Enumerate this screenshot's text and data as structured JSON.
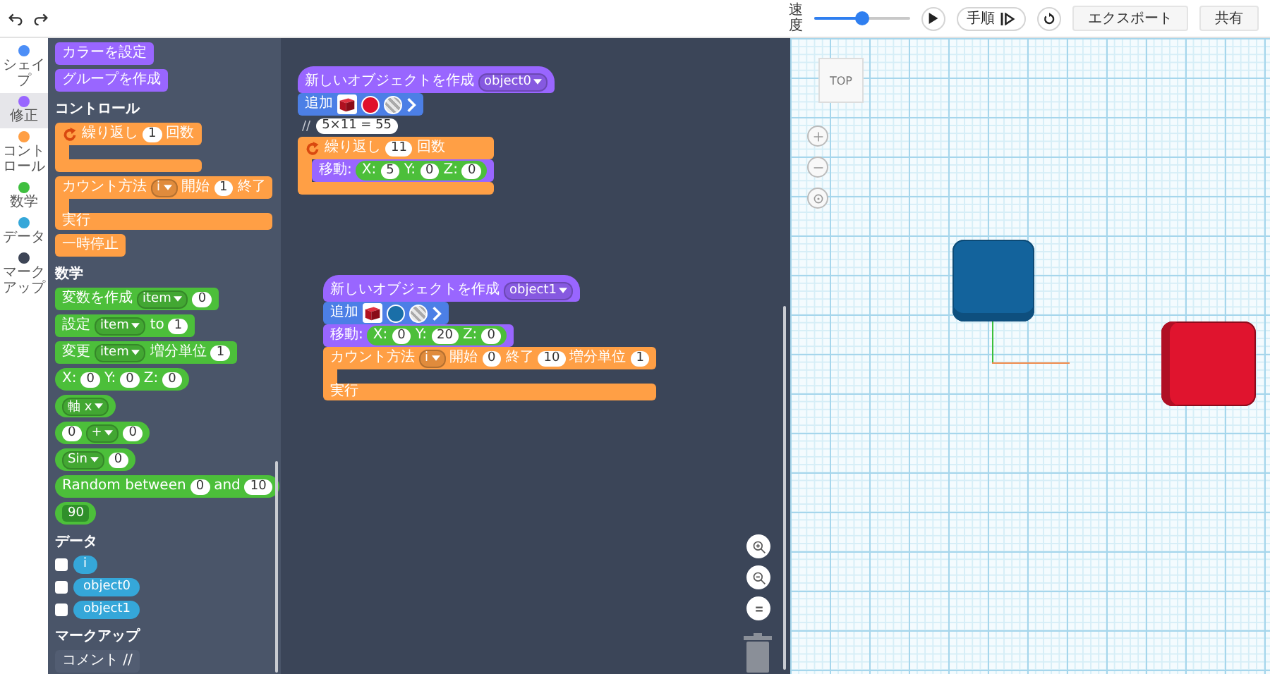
{
  "toolbar": {
    "speed_label": "速度",
    "speed": {
      "level": 0.5
    },
    "step_button": "手順",
    "export_button": "エクスポート",
    "share_button": "共有"
  },
  "categories": [
    {
      "label": "シェイプ",
      "color": "#4c8ef7",
      "selected": false
    },
    {
      "label": "修正",
      "color": "#9966ff",
      "selected": true
    },
    {
      "label": "コントロール",
      "color": "#ff9f45",
      "selected": false
    },
    {
      "label": "数学",
      "color": "#3fbf3f",
      "selected": false
    },
    {
      "label": "データ",
      "color": "#35a7d9",
      "selected": false
    },
    {
      "label": "マークアップ",
      "color": "#3d4556",
      "selected": false
    }
  ],
  "palette": [
    {
      "kind": "block",
      "color": "#9966ff",
      "parts": [
        {
          "kind": "text",
          "text": "カラーを設定"
        }
      ]
    },
    {
      "kind": "block",
      "color": "#9966ff",
      "parts": [
        {
          "kind": "text",
          "text": "グループを作成"
        }
      ]
    },
    {
      "kind": "heading",
      "text": "コントロール"
    },
    {
      "kind": "c_block",
      "color": "#ff9f45",
      "parts": [
        {
          "kind": "repeat_icon"
        },
        {
          "kind": "text",
          "text": "繰り返し"
        },
        {
          "kind": "input",
          "text": "1"
        },
        {
          "kind": "text",
          "text": "回数"
        }
      ]
    },
    {
      "kind": "c_block",
      "color": "#ff9f45",
      "parts": [
        {
          "kind": "text",
          "text": "カウント方法"
        },
        {
          "kind": "dropdown",
          "text": "i"
        },
        {
          "kind": "text",
          "text": "開始"
        },
        {
          "kind": "input",
          "text": "1"
        },
        {
          "kind": "text",
          "text": "終了"
        }
      ],
      "mouth_label": "実行"
    },
    {
      "kind": "block",
      "color": "#ff9f45",
      "parts": [
        {
          "kind": "text",
          "text": "一時停止"
        }
      ]
    },
    {
      "kind": "heading",
      "text": "数学"
    },
    {
      "kind": "block",
      "color": "#4cbf3a",
      "parts": [
        {
          "kind": "text",
          "text": "変数を作成"
        },
        {
          "kind": "dropdown",
          "text": "item"
        },
        {
          "kind": "input",
          "text": "0"
        }
      ]
    },
    {
      "kind": "block",
      "color": "#4cbf3a",
      "parts": [
        {
          "kind": "text",
          "text": "設定"
        },
        {
          "kind": "dropdown",
          "text": "item"
        },
        {
          "kind": "text",
          "text": "to"
        },
        {
          "kind": "input",
          "text": "1"
        }
      ]
    },
    {
      "kind": "block",
      "color": "#4cbf3a",
      "parts": [
        {
          "kind": "text",
          "text": "変更"
        },
        {
          "kind": "dropdown",
          "text": "item"
        },
        {
          "kind": "text",
          "text": "増分単位"
        },
        {
          "kind": "input",
          "text": "1"
        }
      ]
    },
    {
      "kind": "reporter",
      "color": "#4cbf3a",
      "parts": [
        {
          "kind": "text",
          "text": "X:"
        },
        {
          "kind": "input",
          "text": "0"
        },
        {
          "kind": "text",
          "text": "Y:"
        },
        {
          "kind": "input",
          "text": "0"
        },
        {
          "kind": "text",
          "text": "Z:"
        },
        {
          "kind": "input",
          "text": "0"
        }
      ]
    },
    {
      "kind": "reporter",
      "color": "#4cbf3a",
      "parts": [
        {
          "kind": "dropdown",
          "text": "軸 x"
        }
      ]
    },
    {
      "kind": "reporter",
      "color": "#4cbf3a",
      "parts": [
        {
          "kind": "input",
          "text": "0"
        },
        {
          "kind": "dropdown",
          "text": "+"
        },
        {
          "kind": "input",
          "text": "0"
        }
      ]
    },
    {
      "kind": "reporter",
      "color": "#4cbf3a",
      "parts": [
        {
          "kind": "dropdown",
          "text": "Sin"
        },
        {
          "kind": "input",
          "text": "0"
        }
      ]
    },
    {
      "kind": "reporter",
      "color": "#4cbf3a",
      "parts": [
        {
          "kind": "text",
          "text": "Random between"
        },
        {
          "kind": "input",
          "text": "0"
        },
        {
          "kind": "text",
          "text": "and"
        },
        {
          "kind": "input",
          "text": "10"
        }
      ]
    },
    {
      "kind": "reporter",
      "color": "#4cbf3a",
      "parts": [
        {
          "kind": "field",
          "text": "90"
        }
      ]
    },
    {
      "kind": "heading",
      "text": "データ"
    },
    {
      "kind": "variable",
      "checked": false,
      "color": "#35a7d9",
      "text": "i"
    },
    {
      "kind": "variable",
      "checked": false,
      "color": "#35a7d9",
      "text": "object0"
    },
    {
      "kind": "variable",
      "checked": false,
      "color": "#35a7d9",
      "text": "object1"
    },
    {
      "kind": "heading",
      "text": "マークアップ"
    },
    {
      "kind": "block",
      "color": "#525d72",
      "parts": [
        {
          "kind": "text",
          "text": "コメント //"
        }
      ]
    }
  ],
  "workspace": {
    "stacks": [
      {
        "blocks": [
          {
            "kind": "hat",
            "color": "#9966ff",
            "parts": [
              {
                "kind": "text",
                "text": "新しいオブジェクトを作成"
              },
              {
                "kind": "dropdown",
                "text": "object0"
              }
            ]
          },
          {
            "kind": "block",
            "color": "#4c7fe6",
            "parts": [
              {
                "kind": "text",
                "text": "追加"
              },
              {
                "kind": "shape_swatch"
              },
              {
                "kind": "color_swatch",
                "color": "#e0102a"
              },
              {
                "kind": "texture_swatch"
              },
              {
                "kind": "chevron"
              }
            ]
          },
          {
            "kind": "comment",
            "parts": [
              {
                "kind": "text",
                "text": "//"
              },
              {
                "kind": "input",
                "text": "5×11 = 55"
              }
            ]
          },
          {
            "kind": "c_block",
            "color": "#ff9f45",
            "parts": [
              {
                "kind": "repeat_icon"
              },
              {
                "kind": "text",
                "text": "繰り返し"
              },
              {
                "kind": "input",
                "text": "11"
              },
              {
                "kind": "text",
                "text": "回数"
              }
            ],
            "children": [
              {
                "kind": "block",
                "color": "#9966ff",
                "parts": [
                  {
                    "kind": "text",
                    "text": "移動:"
                  },
                  {
                    "kind": "reporter",
                    "color": "#4cbf3a",
                    "parts": [
                      {
                        "kind": "text",
                        "text": "X:"
                      },
                      {
                        "kind": "input",
                        "text": "5"
                      },
                      {
                        "kind": "text",
                        "text": "Y:"
                      },
                      {
                        "kind": "input",
                        "text": "0"
                      },
                      {
                        "kind": "text",
                        "text": "Z:"
                      },
                      {
                        "kind": "input",
                        "text": "0"
                      }
                    ]
                  }
                ]
              }
            ]
          }
        ]
      },
      {
        "blocks": [
          {
            "kind": "hat",
            "color": "#9966ff",
            "parts": [
              {
                "kind": "text",
                "text": "新しいオブジェクトを作成"
              },
              {
                "kind": "dropdown",
                "text": "object1"
              }
            ]
          },
          {
            "kind": "block",
            "color": "#4c7fe6",
            "parts": [
              {
                "kind": "text",
                "text": "追加"
              },
              {
                "kind": "shape_swatch"
              },
              {
                "kind": "color_swatch",
                "color": "#1a6fa8"
              },
              {
                "kind": "texture_swatch"
              },
              {
                "kind": "chevron"
              }
            ]
          },
          {
            "kind": "block",
            "color": "#9966ff",
            "parts": [
              {
                "kind": "text",
                "text": "移動:"
              },
              {
                "kind": "reporter",
                "color": "#4cbf3a",
                "parts": [
                  {
                    "kind": "text",
                    "text": "X:"
                  },
                  {
                    "kind": "input",
                    "text": "0"
                  },
                  {
                    "kind": "text",
                    "text": "Y:"
                  },
                  {
                    "kind": "input",
                    "text": "20"
                  },
                  {
                    "kind": "text",
                    "text": "Z:"
                  },
                  {
                    "kind": "input",
                    "text": "0"
                  }
                ]
              }
            ]
          },
          {
            "kind": "c_block",
            "color": "#ff9f45",
            "parts": [
              {
                "kind": "text",
                "text": "カウント方法"
              },
              {
                "kind": "dropdown",
                "text": "i"
              },
              {
                "kind": "text",
                "text": "開始"
              },
              {
                "kind": "input",
                "text": "0"
              },
              {
                "kind": "text",
                "text": "終了"
              },
              {
                "kind": "input",
                "text": "10"
              },
              {
                "kind": "text",
                "text": "増分単位"
              },
              {
                "kind": "input",
                "text": "1"
              }
            ],
            "mouth_label": "実行"
          }
        ]
      }
    ]
  },
  "viewport": {
    "view_cube_label": "TOP"
  }
}
